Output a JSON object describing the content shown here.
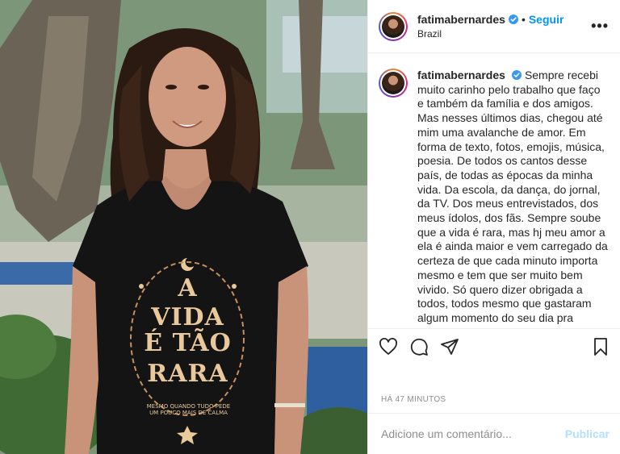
{
  "post": {
    "username": "fatimabernardes",
    "follow_label": "Seguir",
    "separator": "•",
    "location": "Brazil",
    "more_label": "•••",
    "shirt_text": {
      "line1": "A",
      "line2": "VIDA",
      "line3": "É TÃO",
      "line4": "RARA",
      "small": "MESMO QUANDO TUDO PEDE UM POUCO MAIS DE CALMA"
    },
    "caption": "Sempre recebi muito carinho pelo trabalho que faço e também da família e dos amigos. Mas nesses últimos dias, chegou até mim uma avalanche de amor. Em forma de texto, fotos, emojis, música, poesia. De todos os cantos desse país, de todas as épocas da minha vida. Da escola, da dança, do jornal, da TV. Dos meus entrevistados, dos meus ídolos, dos fãs. Sempre soube que a vida é rara, mas hj meu amor a ela é ainda maior e vem carregado da certeza de que cada minuto importa mesmo e tem que ser muito bem vivido. Só quero dizer obrigada a todos, todos mesmo que gastaram algum momento do seu dia pra pensar em mim, pra rezar, pra me mandar",
    "timestamp": "HÁ 47 MINUTOS",
    "comment_placeholder": "Adicione um comentário...",
    "publish_label": "Publicar"
  },
  "icons": {
    "like": "heart-icon",
    "comment": "comment-icon",
    "share": "send-icon",
    "save": "bookmark-icon",
    "verified": "verified-badge-icon"
  },
  "colors": {
    "accent": "#0095f6",
    "verified": "#3897f0",
    "publish_disabled": "#b2dffc",
    "muted": "#8e8e8e",
    "text": "#262626"
  }
}
